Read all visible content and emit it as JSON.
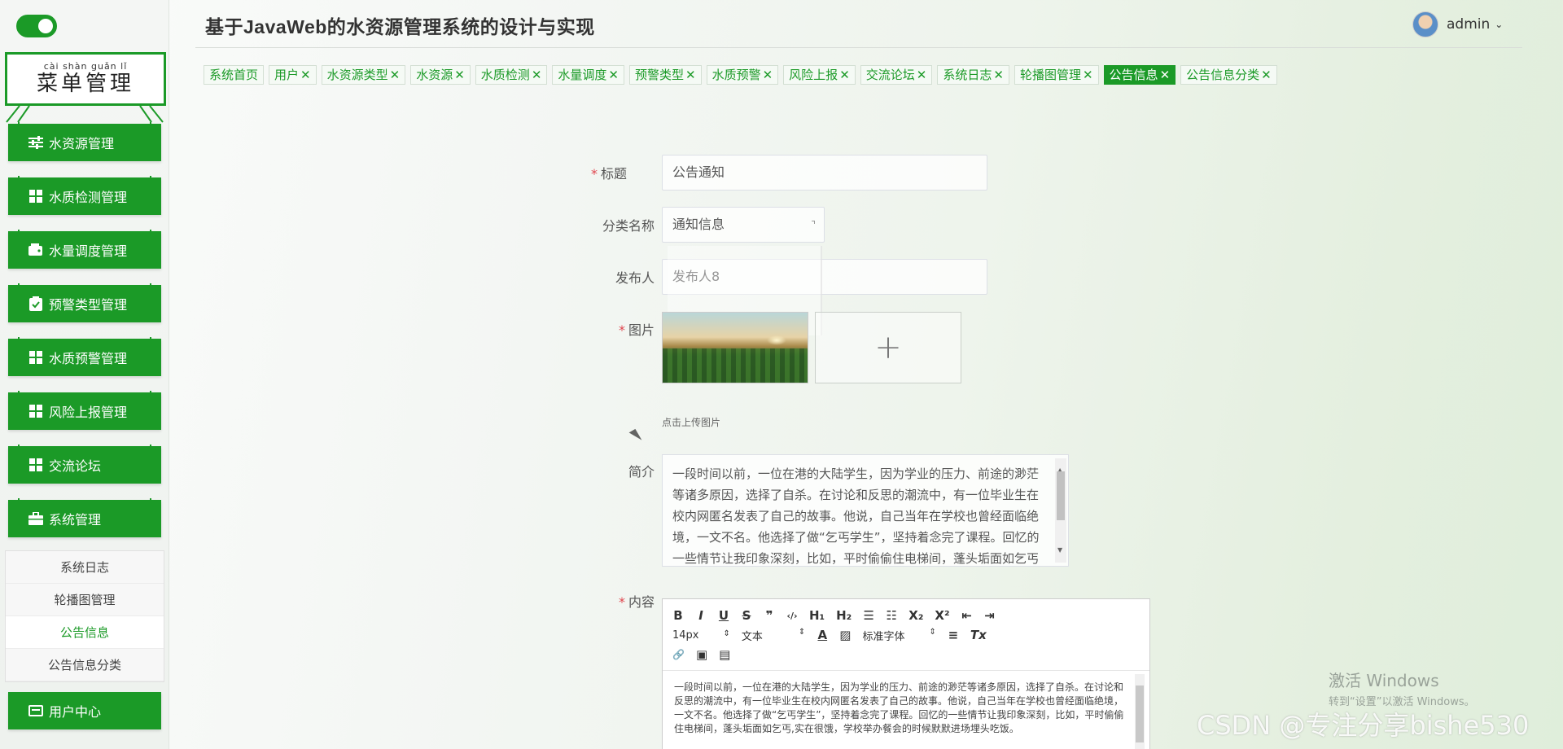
{
  "app_title": "基于JavaWeb的水资源管理系统的设计与实现",
  "user": {
    "name": "admin"
  },
  "sidebar": {
    "title_pinyin": "cài shàn guǎn lǐ",
    "title": "菜单管理",
    "items": [
      {
        "label": "水资源管理",
        "icon": "sliders-icon"
      },
      {
        "label": "水质检测管理",
        "icon": "grid-icon"
      },
      {
        "label": "水量调度管理",
        "icon": "wallet-icon"
      },
      {
        "label": "预警类型管理",
        "icon": "clipboard-check-icon"
      },
      {
        "label": "水质预警管理",
        "icon": "grid-icon"
      },
      {
        "label": "风险上报管理",
        "icon": "grid-icon"
      },
      {
        "label": "交流论坛",
        "icon": "grid-icon"
      },
      {
        "label": "系统管理",
        "icon": "briefcase-icon"
      }
    ],
    "submenu": [
      "系统日志",
      "轮播图管理",
      "公告信息",
      "公告信息分类"
    ],
    "submenu_active": "公告信息",
    "user_center": {
      "label": "用户中心",
      "icon": "id-card-icon"
    }
  },
  "tabs": [
    {
      "label": "系统首页",
      "closable": false
    },
    {
      "label": "用户",
      "closable": true
    },
    {
      "label": "水资源类型",
      "closable": true
    },
    {
      "label": "水资源",
      "closable": true
    },
    {
      "label": "水质检测",
      "closable": true
    },
    {
      "label": "水量调度",
      "closable": true
    },
    {
      "label": "预警类型",
      "closable": true
    },
    {
      "label": "水质预警",
      "closable": true
    },
    {
      "label": "风险上报",
      "closable": true
    },
    {
      "label": "交流论坛",
      "closable": true
    },
    {
      "label": "系统日志",
      "closable": true
    },
    {
      "label": "轮播图管理",
      "closable": true
    },
    {
      "label": "公告信息",
      "closable": true,
      "active": true
    },
    {
      "label": "公告信息分类",
      "closable": true
    }
  ],
  "close_glyph": "✕",
  "form": {
    "title_label": "标题",
    "title_value": "公告通知",
    "category_label": "分类名称",
    "category_value": "通知信息",
    "publisher_label": "发布人",
    "publisher_value": "发布人8",
    "image_label": "图片",
    "upload_plus": "+",
    "upload_hint": "点击上传图片",
    "intro_label": "简介",
    "intro_value": "一段时间以前，一位在港的大陆学生，因为学业的压力、前途的渺茫等诸多原因，选择了自杀。在讨论和反思的潮流中，有一位毕业生在校内网匿名发表了自己的故事。他说，自己当年在学校也曾经面临绝境，一文不名。他选择了做“乞丐学生”，坚持着念完了课程。回忆的一些情节让我印象深刻，比如，平时偷偷住电梯间，蓬头垢面如乞丐实在很饿，学校举办餐会的时候默默进场埋头吃饭。",
    "content_label": "内容",
    "content_value": "一段时间以前，一位在港的大陆学生，因为学业的压力、前途的渺茫等诸多原因，选择了自杀。在讨论和反思的潮流中，有一位毕业生在校内网匿名发表了自己的故事。他说，自己当年在学校也曾经面临绝境，一文不名。他选择了做“乞丐学生”，坚持着念完了课程。回忆的一些情节让我印象深刻，比如，平时偷偷住电梯间，蓬头垢面如乞丐,实在很饿，学校举办餐会的时候默默进场埋头吃饭。"
  },
  "editor": {
    "font_size": "14px",
    "paragraph": "文本",
    "font_family": "标准字体",
    "buttons_row1": [
      "B",
      "I",
      "U",
      "S",
      "❞",
      "‹/›",
      "H₁",
      "H₂",
      "☰",
      "☷",
      "X₂",
      "X²",
      "⇤",
      "⇥"
    ],
    "icons_row2": [
      "A",
      "▨",
      "≡",
      "Tx"
    ],
    "icons_row3": [
      "🔗",
      "▣",
      "▤"
    ]
  },
  "watermarks": {
    "windows_title": "激活 Windows",
    "windows_sub": "转到“设置”以激活 Windows。",
    "csdn": "CSDN @专注分享bishe530"
  },
  "colors": {
    "primary": "#1b9a27",
    "required": "#e0464e"
  }
}
